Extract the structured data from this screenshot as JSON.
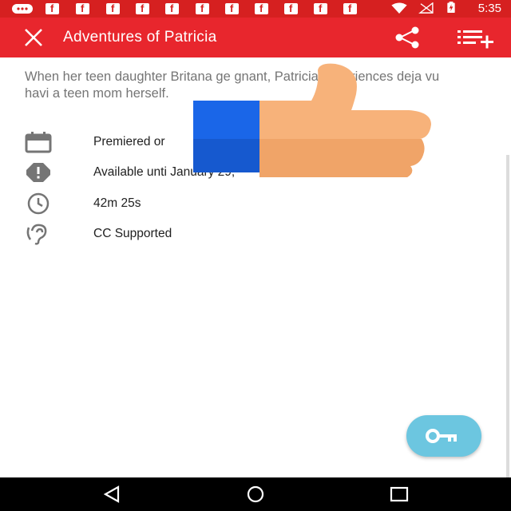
{
  "status_bar": {
    "time": "5:35",
    "notification_icons": [
      "chat-icon",
      "facebook-icon",
      "facebook-icon",
      "facebook-icon",
      "facebook-icon",
      "facebook-icon",
      "facebook-icon",
      "facebook-icon",
      "facebook-icon",
      "facebook-icon",
      "facebook-icon"
    ],
    "system_icons": [
      "wifi-icon",
      "signal-off-icon",
      "battery-charging-icon"
    ],
    "facebook_glyph": "f"
  },
  "app_bar": {
    "title": "Adventures of Patricia",
    "color": "#e8262d"
  },
  "details": {
    "description": "When her teen daughter Britana ge     gnant, Patricia experiences deja vu havi        a teen mom herself.",
    "rows": [
      {
        "icon": "calendar-icon",
        "text": "Premiered or"
      },
      {
        "icon": "alert-octagon-icon",
        "text": "Available unti  January 29,"
      },
      {
        "icon": "clock-icon",
        "text": "42m 25s"
      },
      {
        "icon": "hearing-icon",
        "text": "CC Supported"
      }
    ]
  },
  "fab": {
    "icon": "key-icon",
    "color": "#6cc6e0"
  },
  "overlay": {
    "icon": "thumbs-up-icon",
    "cuff_color": "#1a66e8",
    "hand_color": "#f7b27a"
  },
  "nav_bar": {
    "icons": [
      "back-icon",
      "home-icon",
      "recents-icon"
    ]
  }
}
